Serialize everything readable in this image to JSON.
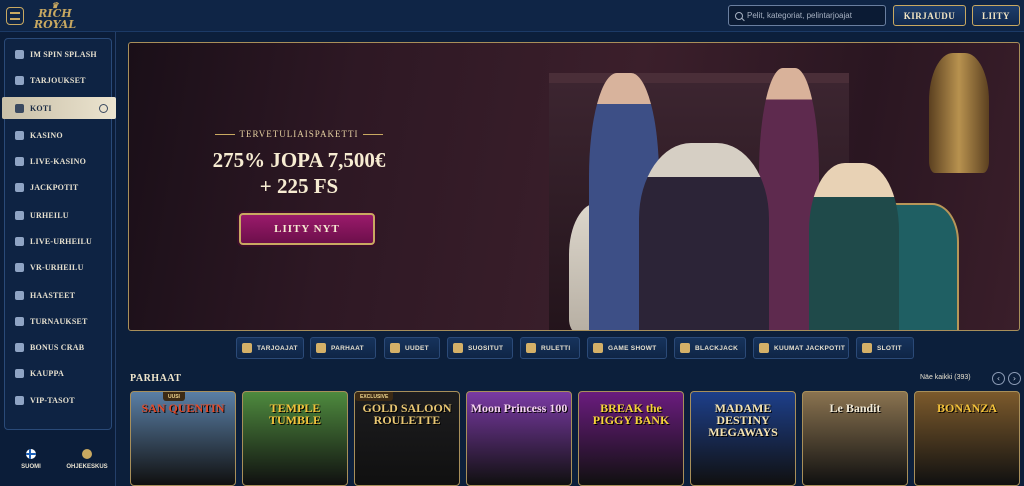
{
  "header": {
    "logo_text": "RICH ROYAL",
    "search_placeholder": "Pelit, kategoriat, pelintarjoajat",
    "login_label": "KIRJAUDU",
    "join_label": "LIITY"
  },
  "sidebar": {
    "items": [
      {
        "label": "IM SPIN SPLASH",
        "icon": "spin-icon"
      },
      {
        "label": "TARJOUKSET",
        "icon": "gift-icon"
      },
      {
        "label": "KOTI",
        "icon": "home-icon",
        "active": true
      },
      {
        "label": "KASINO",
        "icon": "casino-icon"
      },
      {
        "label": "LIVE-KASINO",
        "icon": "live-casino-icon"
      },
      {
        "label": "JACKPOTIT",
        "icon": "jackpot-icon"
      },
      {
        "label": "URHEILU",
        "icon": "ball-icon"
      },
      {
        "label": "LIVE-URHEILU",
        "icon": "live-sports-icon"
      },
      {
        "label": "VR-URHEILU",
        "icon": "vr-icon"
      },
      {
        "label": "HAASTEET",
        "icon": "challenge-icon"
      },
      {
        "label": "TURNAUKSET",
        "icon": "trophy-icon"
      },
      {
        "label": "BONUS CRAB",
        "icon": "crab-icon"
      },
      {
        "label": "KAUPPA",
        "icon": "shop-icon"
      },
      {
        "label": "VIP-TASOT",
        "icon": "vip-icon"
      }
    ],
    "language_label": "SUOMI",
    "help_label": "OHJEKESKUS"
  },
  "hero": {
    "kicker": "TERVETULIAISPAKETTI",
    "title_line1": "275% JOPA 7,500€",
    "title_line2": "+ 225 FS",
    "cta_label": "LIITY NYT"
  },
  "categories": [
    {
      "label": "TARJOAJAT",
      "icon": "provider-icon"
    },
    {
      "label": "PARHAAT",
      "icon": "crown-icon"
    },
    {
      "label": "UUDET",
      "icon": "bolt-icon"
    },
    {
      "label": "SUOSITUT",
      "icon": "star-icon"
    },
    {
      "label": "RULETTI",
      "icon": "roulette-icon"
    },
    {
      "label": "GAME SHOWT",
      "icon": "mic-icon"
    },
    {
      "label": "BLACKJACK",
      "icon": "cards-icon"
    },
    {
      "label": "KUUMAT JACKPOTIT",
      "icon": "flame-icon"
    },
    {
      "label": "SLOTIT",
      "icon": "slot-icon"
    }
  ],
  "games_section": {
    "title": "PARHAAT",
    "see_all": "Näe kaikki (393)",
    "games": [
      {
        "title": "SAN QUENTIN",
        "badge": "UUSI",
        "bg": "#5a7fa6",
        "color": "#e24a2a"
      },
      {
        "title": "TEMPLE TUMBLE",
        "badge": "",
        "bg": "#4e8a3e",
        "color": "#f2c23a"
      },
      {
        "title": "GOLD SALOON ROULETTE",
        "badge": "EXCLUSIVE",
        "bg": "#1d1d1f",
        "color": "#e9c773"
      },
      {
        "title": "Moon Princess 100",
        "badge": "",
        "bg": "#7a3aa4",
        "color": "#f6d3f0"
      },
      {
        "title": "BREAK the PIGGY BANK",
        "badge": "",
        "bg": "#6a1c7e",
        "color": "#f7d33a"
      },
      {
        "title": "MADAME DESTINY MEGAWAYS",
        "badge": "",
        "bg": "#1d3f8a",
        "color": "#f5e3b0"
      },
      {
        "title": "Le Bandit",
        "badge": "",
        "bg": "#8a7350",
        "color": "#f2ebd8"
      },
      {
        "title": "BONANZA",
        "badge": "",
        "bg": "#7c5a2c",
        "color": "#f2c13a"
      }
    ]
  }
}
